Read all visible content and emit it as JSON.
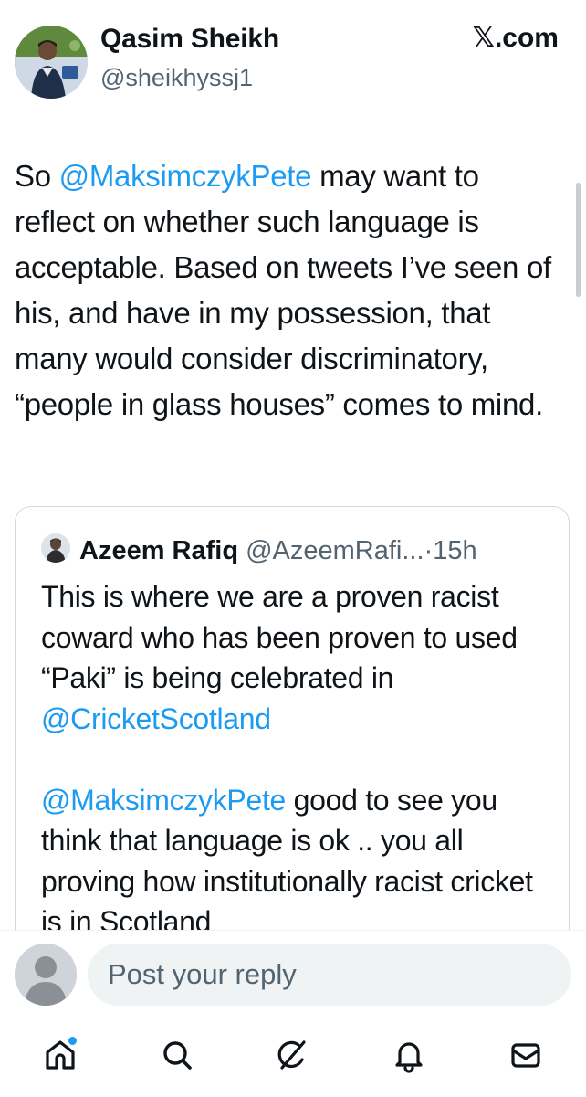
{
  "header": {
    "author_name": "Qasim Sheikh",
    "author_handle": "@sheikhyssj1",
    "site": "𝕏.com"
  },
  "tweet": {
    "parts": [
      {
        "text": "So ",
        "mention": false
      },
      {
        "text": "@MaksimczykPete",
        "mention": true
      },
      {
        "text": " may want to reflect on whether such language is acceptable. Based on tweets I’ve seen of his, and have in my possession, that many would consider discriminatory, “people in glass houses” comes to mind.",
        "mention": false
      }
    ]
  },
  "quote": {
    "name": "Azeem Rafiq",
    "handle": "@AzeemRafi...",
    "separator": "·",
    "time": "15h",
    "para1": {
      "text": "This is where we are a proven racist coward who has been proven to used “Paki” is being celebrated in ",
      "mention": "@CricketScotland"
    },
    "para2": {
      "mention": "@MaksimczykPete",
      "text": " good to see you think that language is ok .. you all proving how institutionally racist cricket is in Scotland"
    }
  },
  "reply": {
    "placeholder": "Post your reply"
  },
  "nav": {
    "items": [
      "home-icon",
      "search-icon",
      "grok-icon",
      "notifications-icon",
      "messages-icon"
    ],
    "accent": "#1d9bf0"
  }
}
